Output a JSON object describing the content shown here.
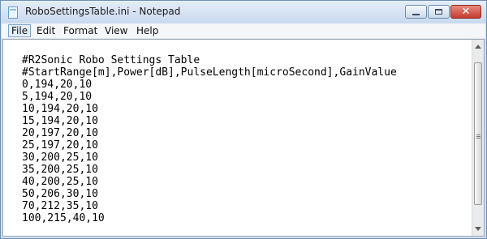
{
  "window": {
    "title": "RoboSettingsTable.ini - Notepad",
    "app_icon": "notepad-icon",
    "controls": {
      "minimize": "minimize-icon",
      "maximize": "maximize-icon",
      "close": "✕"
    }
  },
  "menu": {
    "file": "File",
    "edit": "Edit",
    "format": "Format",
    "view": "View",
    "help": "Help"
  },
  "editor": {
    "lines": [
      "#R2Sonic Robo Settings Table",
      "#StartRange[m],Power[dB],PulseLength[microSecond],GainValue",
      "0,194,20,10",
      "5,194,20,10",
      "10,194,20,10",
      "15,194,20,10",
      "20,197,20,10",
      "25,197,20,10",
      "30,200,25,10",
      "35,200,25,10",
      "40,200,25,10",
      "50,206,30,10",
      "70,212,35,10",
      "100,215,40,10"
    ]
  },
  "colors": {
    "titlebar": "#c8d9ee",
    "close_button": "#c53c2f",
    "menu_background": "#f5f6f7"
  }
}
